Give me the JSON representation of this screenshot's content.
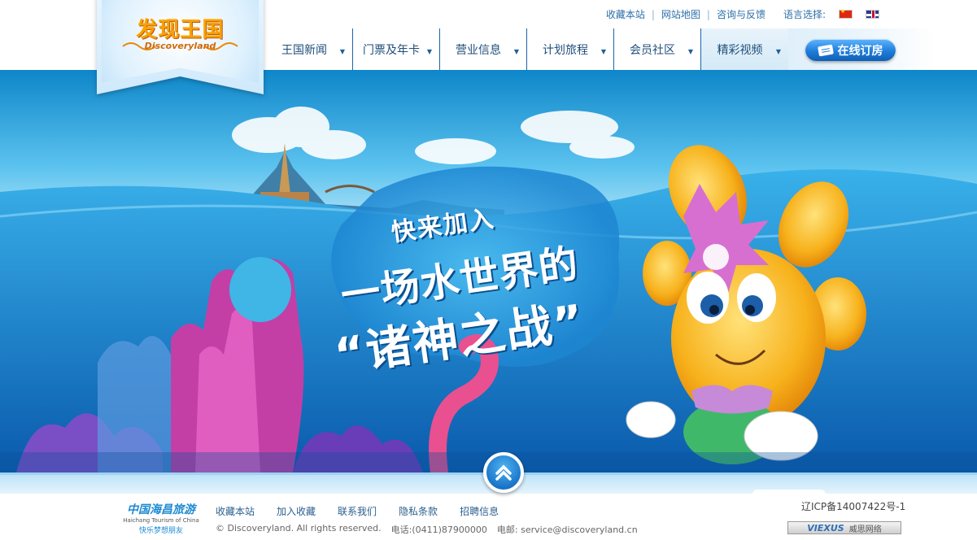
{
  "header": {
    "logo": {
      "cn": "发现王国",
      "en": "Discoveryland"
    },
    "top_links": [
      {
        "label": "收藏本站"
      },
      {
        "label": "网站地图"
      },
      {
        "label": "咨询与反馈"
      }
    ],
    "language_label": "语言选择:",
    "languages": [
      {
        "name": "chinese-flag-icon"
      },
      {
        "name": "uk-flag-icon"
      }
    ],
    "nav": [
      {
        "label": "王国新闻"
      },
      {
        "label": "门票及年卡"
      },
      {
        "label": "营业信息"
      },
      {
        "label": "计划旅程"
      },
      {
        "label": "会员社区"
      },
      {
        "label": "精彩视频"
      }
    ],
    "book_button": "在线订房"
  },
  "hero": {
    "slogan": [
      "快来加入",
      "一场水世界的",
      "“诸神之战”"
    ]
  },
  "footer": {
    "partner_logo": {
      "cn": "中国海昌旅游",
      "en": "Haichang Tourism of China",
      "tagline": "快乐梦想朋友"
    },
    "links": [
      "收藏本站",
      "加入收藏",
      "联系我们",
      "隐私条款",
      "招聘信息"
    ],
    "copyright": "© Discoveryland. All rights reserved.",
    "phone_label": "电话:",
    "phone": "(0411)87900000",
    "email_label": "电邮:",
    "email": "service@discoveryland.cn",
    "icp": "辽ICP备14007422号-1",
    "credit_brand": "VIEXUS",
    "credit_cn": "威思网络"
  },
  "colors": {
    "nav_text": "#1f4e7a",
    "link_blue": "#2b6fa8",
    "logo_orange": "#f5a20b",
    "book_button": "#1f7ed9",
    "hero_sea": "#1a7fcf"
  }
}
